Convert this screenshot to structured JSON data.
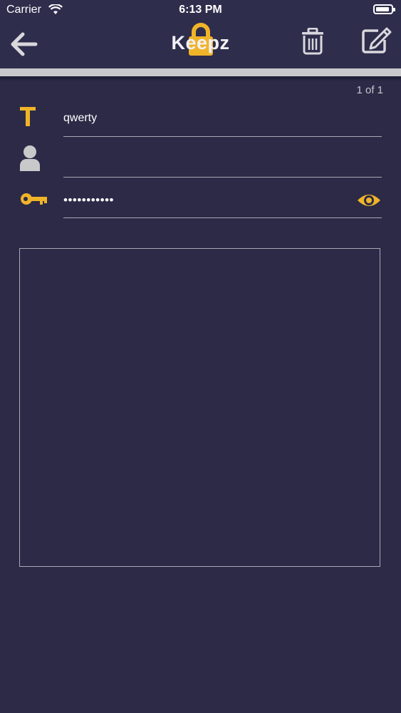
{
  "status_bar": {
    "carrier": "Carrier",
    "time": "6:13 PM"
  },
  "nav": {
    "title": "Keepz"
  },
  "pager": "1 of 1",
  "entry": {
    "title_value": "qwerty",
    "username_value": "",
    "password_masked": "•••••••••••",
    "notes": ""
  },
  "colors": {
    "background": "#2c2a46",
    "accent": "#f0b429",
    "line": "#a9a9b6",
    "icon_gray": "#c9c9cc"
  },
  "icons": {
    "back": "arrow-left-icon",
    "lock": "lock-icon",
    "trash": "trash-icon",
    "edit": "edit-icon",
    "title": "text-icon",
    "user": "user-icon",
    "key": "key-icon",
    "eye": "eye-icon"
  }
}
